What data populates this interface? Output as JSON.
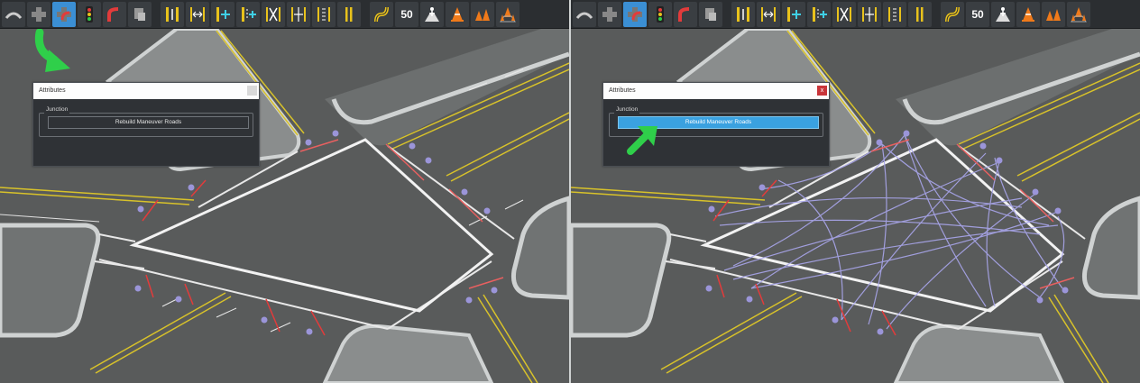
{
  "toolbar": {
    "tools": [
      {
        "icon": "road-icon"
      },
      {
        "icon": "junction-icon"
      },
      {
        "icon": "junction-connect-icon",
        "selected": true
      },
      {
        "icon": "traffic-light-icon"
      },
      {
        "icon": "road-curve-icon"
      },
      {
        "icon": "signal-pole-icon"
      },
      {
        "icon": "lane-direction-icon"
      },
      {
        "icon": "lane-width-icon"
      },
      {
        "icon": "lane-add-icon"
      },
      {
        "icon": "lane-add-right-icon"
      },
      {
        "icon": "lane-merge-icon"
      },
      {
        "icon": "lane-split-icon"
      },
      {
        "icon": "lane-marking-icon"
      },
      {
        "icon": "double-line-icon"
      },
      {
        "icon": "curvy-road-icon"
      },
      {
        "icon": "speed-limit-icon",
        "text": "50"
      },
      {
        "icon": "pedestrian-crossing-icon"
      },
      {
        "icon": "traffic-cone-icon"
      },
      {
        "icon": "cone-group-icon"
      },
      {
        "icon": "cone-area-icon"
      }
    ],
    "colors": {
      "selected": "#3b8fd4",
      "background": "#2b2e31"
    }
  },
  "left": {
    "dialog": {
      "title": "Attributes",
      "close": "",
      "group_label": "Junction",
      "button_label": "Rebuild Maneuver Roads"
    }
  },
  "right": {
    "dialog": {
      "title": "Attributes",
      "close": "x",
      "group_label": "Junction",
      "button_label": "Rebuild Maneuver Roads"
    }
  },
  "colors": {
    "road": "#595b5b",
    "sidewalk": "#cfd2d2",
    "yellow_line": "#d8c22a",
    "stop_line": "#e23b3b",
    "marker": "#9b95d9",
    "maneuver": "#a9a6ec",
    "arrow": "#2fcf4a",
    "active_button": "#3aa1e0"
  }
}
